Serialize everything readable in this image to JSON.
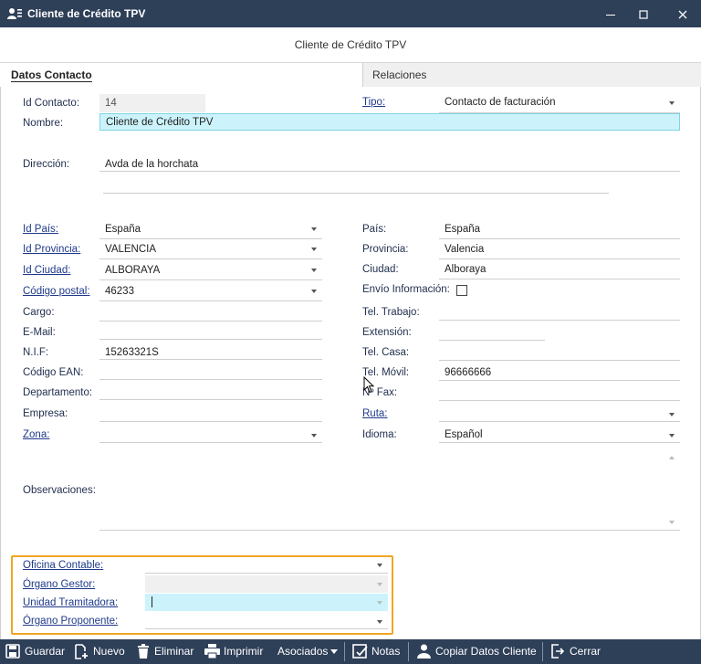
{
  "window": {
    "title": "Cliente de Crédito TPV",
    "minimize_icon": "minimize-icon",
    "maximize_icon": "maximize-icon",
    "close_icon": "close-icon"
  },
  "subtitle": "Cliente de Crédito TPV",
  "tabs": [
    {
      "label": "Datos Contacto",
      "active": true
    },
    {
      "label": "Relaciones",
      "active": false
    }
  ],
  "form": {
    "id_contacto": {
      "label": "Id Contacto:",
      "value": "14"
    },
    "tipo": {
      "label": "Tipo:",
      "value": "Contacto de facturación"
    },
    "nombre": {
      "label": "Nombre:",
      "value": "Cliente de Crédito TPV"
    },
    "direccion": {
      "label": "Dirección:",
      "value": "Avda de la horchata",
      "value2": ""
    },
    "id_pais": {
      "label": "Id País:",
      "value": "España"
    },
    "pais": {
      "label": "País:",
      "value": "España"
    },
    "id_provincia": {
      "label": "Id Provincia:",
      "value": "VALENCIA"
    },
    "provincia": {
      "label": "Provincia:",
      "value": "Valencia"
    },
    "id_ciudad": {
      "label": "Id Ciudad:",
      "value": "ALBORAYA"
    },
    "ciudad": {
      "label": "Ciudad:",
      "value": "Alboraya"
    },
    "codigo_postal": {
      "label": "Código postal:",
      "value": "46233"
    },
    "envio_informacion": {
      "label": "Envío Información:",
      "checked": false
    },
    "cargo": {
      "label": "Cargo:",
      "value": ""
    },
    "tel_trabajo": {
      "label": "Tel. Trabajo:",
      "value": ""
    },
    "email": {
      "label": "E-Mail:",
      "value": ""
    },
    "extension": {
      "label": "Extensión:",
      "value": ""
    },
    "nif": {
      "label": "N.I.F:",
      "value": "15263321S"
    },
    "tel_casa": {
      "label": "Tel. Casa:",
      "value": ""
    },
    "codigo_ean": {
      "label": "Código EAN:",
      "value": ""
    },
    "tel_movil": {
      "label": "Tel. Móvil:",
      "value": "96666666"
    },
    "departamento": {
      "label": "Departamento:",
      "value": ""
    },
    "fax": {
      "label": "Nº Fax:",
      "value": ""
    },
    "empresa": {
      "label": "Empresa:",
      "value": ""
    },
    "ruta": {
      "label": "Ruta:",
      "value": ""
    },
    "zona": {
      "label": "Zona:",
      "value": ""
    },
    "idioma": {
      "label": "Idioma:",
      "value": "Español"
    },
    "observaciones": {
      "label": "Observaciones:",
      "value": ""
    },
    "oficina_contable": {
      "label": "Oficina Contable:",
      "value": ""
    },
    "organo_gestor": {
      "label": "Órgano Gestor:",
      "value": ""
    },
    "unidad_tramitadora": {
      "label": "Unidad Tramitadora:",
      "value": ""
    },
    "organo_proponente": {
      "label": "Órgano Proponente:",
      "value": ""
    }
  },
  "toolbar": {
    "guardar": "Guardar",
    "nuevo": "Nuevo",
    "eliminar": "Eliminar",
    "imprimir": "Imprimir",
    "asociados": "Asociados",
    "notas": "Notas",
    "copiar": "Copiar Datos Cliente",
    "cerrar": "Cerrar"
  },
  "colors": {
    "titlebar": "#2e3f58",
    "highlight": "#ccf3fb",
    "orange_frame": "#f0a623"
  }
}
